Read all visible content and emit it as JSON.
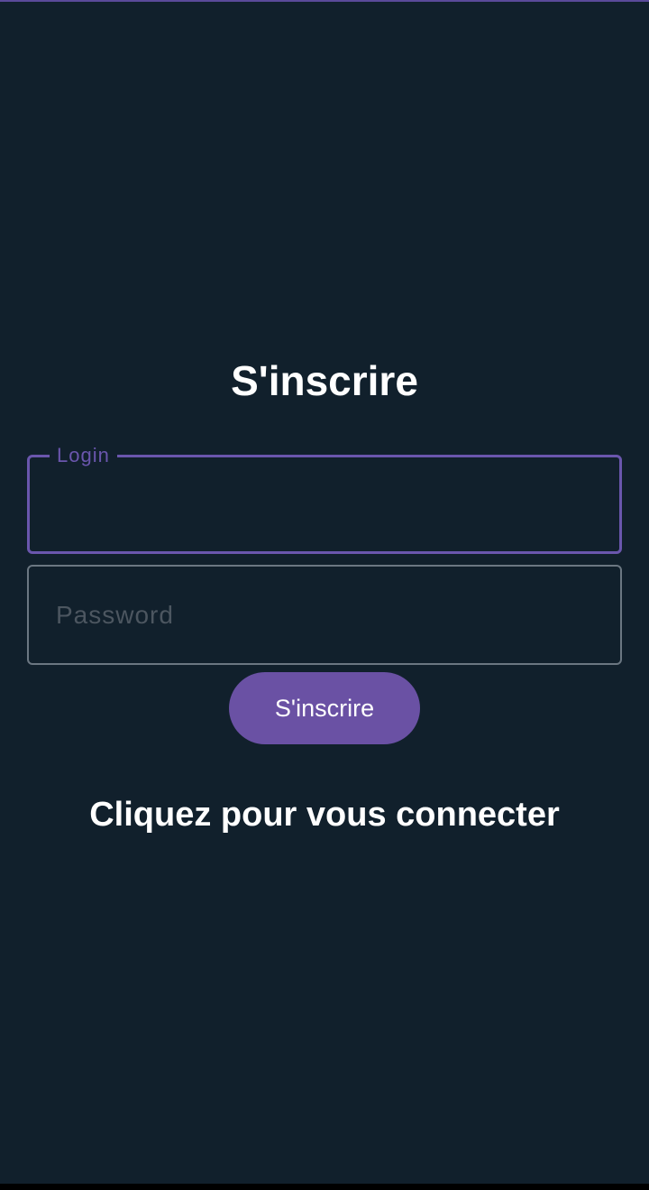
{
  "header": {
    "title": "S'inscrire"
  },
  "form": {
    "login": {
      "label": "Login",
      "value": "",
      "state": "focused"
    },
    "password": {
      "placeholder": "Password",
      "value": ""
    },
    "submit_label": "S'inscrire"
  },
  "footer": {
    "login_link": "Cliquez pour vous connecter"
  },
  "colors": {
    "background": "#11202c",
    "accent": "#6a51a4",
    "text": "#ffffff",
    "placeholder": "#4c5660",
    "field_border": "#6b7782"
  }
}
